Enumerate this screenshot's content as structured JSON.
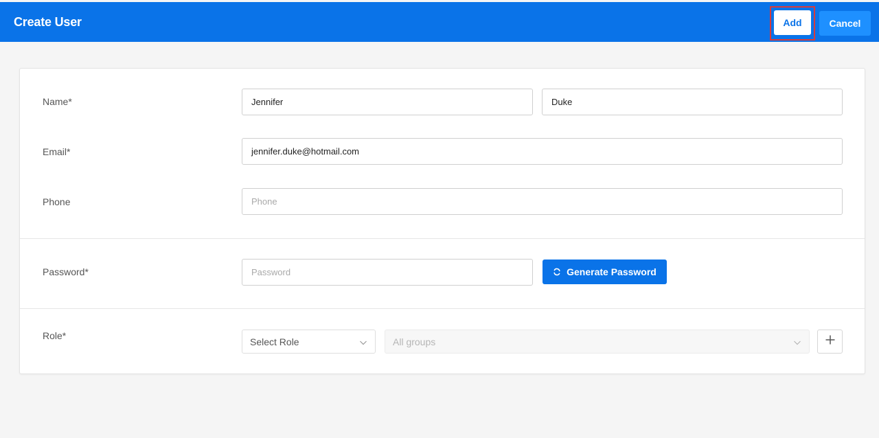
{
  "header": {
    "title": "Create User",
    "add_label": "Add",
    "cancel_label": "Cancel"
  },
  "form": {
    "name": {
      "label": "Name*",
      "first_value": "Jennifer",
      "last_value": "Duke"
    },
    "email": {
      "label": "Email*",
      "value": "jennifer.duke@hotmail.com"
    },
    "phone": {
      "label": "Phone",
      "placeholder": "Phone"
    },
    "password": {
      "label": "Password*",
      "placeholder": "Password",
      "generate_label": "Generate Password"
    },
    "role": {
      "label": "Role*",
      "role_select_value": "Select Role",
      "group_select_value": "All groups"
    }
  },
  "icons": {
    "generate": "refresh-icon",
    "dropdown": "chevron-down-icon",
    "add_role": "plus-icon"
  },
  "colors": {
    "primary": "#0a73e8",
    "cancel_button": "#1e90ff",
    "highlight": "#d93a3a",
    "background": "#f5f5f5"
  }
}
